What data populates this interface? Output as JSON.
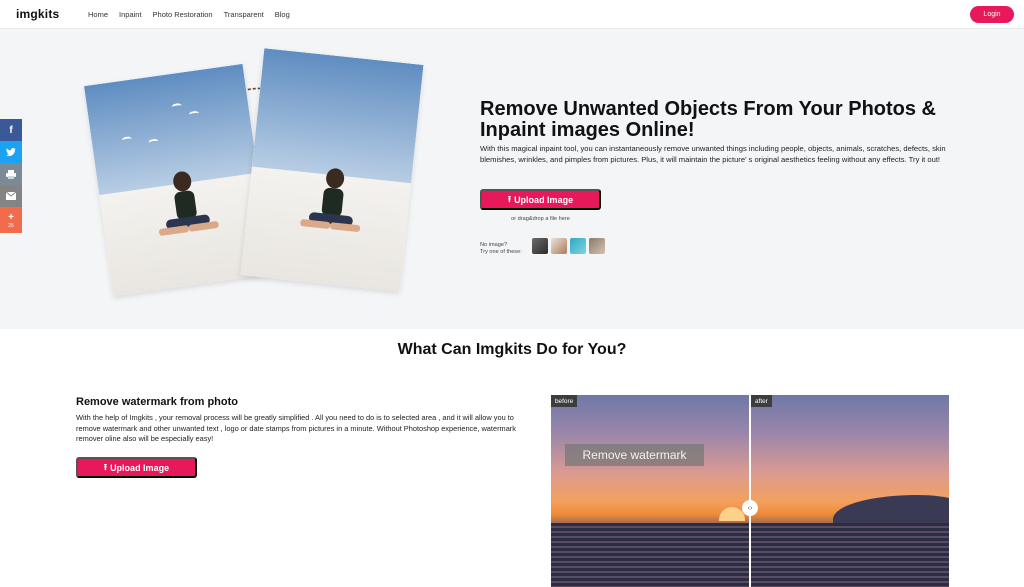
{
  "header": {
    "logo": "imgkits",
    "nav": [
      "Home",
      "Inpaint",
      "Photo Restoration",
      "Transparent",
      "Blog"
    ],
    "login_label": "Login"
  },
  "share": {
    "icons": [
      "facebook-icon",
      "twitter-icon",
      "print-icon",
      "email-icon",
      "plus-icon"
    ],
    "count": "25"
  },
  "hero": {
    "title": "Remove Unwanted Objects From Your Photos & Inpaint images Online!",
    "description": "With this magical inpaint tool, you can instantaneously remove unwanted things including people, objects, animals, scratches, defects, skin blemishes, wrinkles, and pimples from pictures. Plus, it will maintain the picture’ s original aesthetics feeling without any effects. Try it out!",
    "upload_label": "Upload Image",
    "drag_text": "or drag&drop a file here",
    "no_image_line1": "No image?",
    "no_image_line2": "Try one of these:"
  },
  "section": {
    "title": "What Can Imgkits Do for You?"
  },
  "feature": {
    "title": "Remove watermark from photo",
    "description": "With the help of Imgkits , your removal process will be greatly simplified . All you need to do is to selected area , and it will allow you to remove watermark and other unwanted text ,  logo or date stamps from pictures in a minute. Without Photoshop experience, watermark remover oline also will be especially easy!",
    "upload_label": "Upload Image",
    "before_label": "before",
    "after_label": "after",
    "watermark_text": "Remove watermark"
  },
  "colors": {
    "accent": "#e8195a",
    "hero_bg": "#f4f5f7"
  }
}
